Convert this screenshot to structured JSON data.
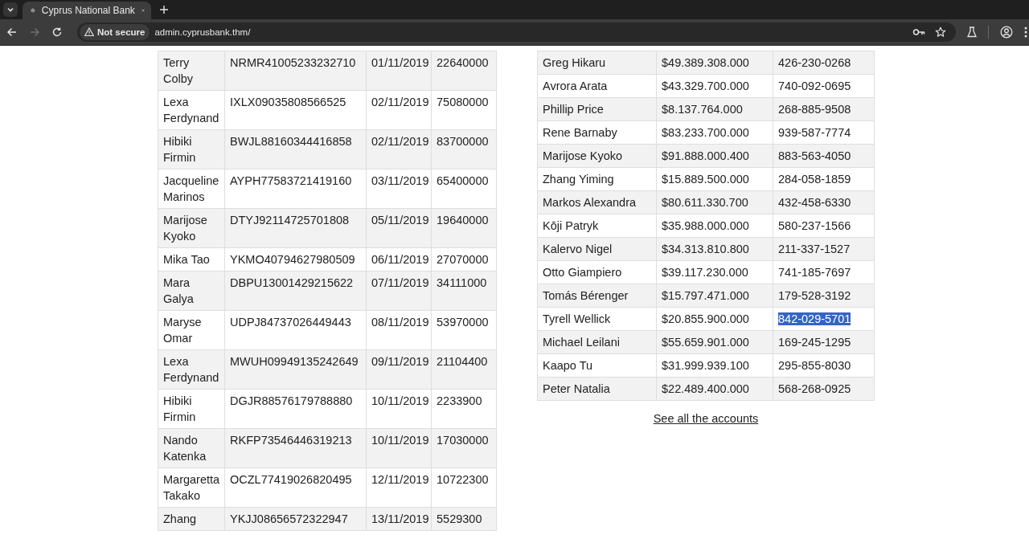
{
  "browser": {
    "tab": {
      "title": "Cyprus National Bank",
      "selected": true
    },
    "security": "Not secure",
    "url": "admin.cyprusbank.thm/",
    "forward_disabled": true
  },
  "transactions": {
    "rows": [
      {
        "name": "Terry Colby",
        "account": "NRMR41005233232710",
        "date": "01/11/2019",
        "amount": "22640000"
      },
      {
        "name": "Lexa Ferdynand",
        "account": "IXLX09035808566525",
        "date": "02/11/2019",
        "amount": "75080000"
      },
      {
        "name": "Hibiki Firmin",
        "account": "BWJL88160344416858",
        "date": "02/11/2019",
        "amount": "83700000"
      },
      {
        "name": "Jacqueline Marinos",
        "account": "AYPH77583721419160",
        "date": "03/11/2019",
        "amount": "65400000"
      },
      {
        "name": "Marijose Kyoko",
        "account": "DTYJ92114725701808",
        "date": "05/11/2019",
        "amount": "19640000"
      },
      {
        "name": "Mika Tao",
        "account": "YKMO40794627980509",
        "date": "06/11/2019",
        "amount": "27070000"
      },
      {
        "name": "Mara Galya",
        "account": "DBPU13001429215622",
        "date": "07/11/2019",
        "amount": "34111000"
      },
      {
        "name": "Maryse Omar",
        "account": "UDPJ84737026449443",
        "date": "08/11/2019",
        "amount": "53970000"
      },
      {
        "name": "Lexa Ferdynand",
        "account": "MWUH09949135242649",
        "date": "09/11/2019",
        "amount": "21104400"
      },
      {
        "name": "Hibiki Firmin",
        "account": "DGJR88576179788880",
        "date": "10/11/2019",
        "amount": "2233900"
      },
      {
        "name": "Nando Katenka",
        "account": "RKFP73546446319213",
        "date": "10/11/2019",
        "amount": "17030000"
      },
      {
        "name": "Margaretta Takako",
        "account": "OCZL77419026820495",
        "date": "12/11/2019",
        "amount": "10722300"
      },
      {
        "name": "Zhang",
        "account": "YKJJ08656572322947",
        "date": "13/11/2019",
        "amount": "5529300"
      }
    ]
  },
  "accounts": {
    "rows": [
      {
        "name": "Greg Hikaru",
        "balance": "$49.389.308.000",
        "phone": "426-230-0268",
        "phone_selected": false
      },
      {
        "name": "Avrora Arata",
        "balance": "$43.329.700.000",
        "phone": "740-092-0695",
        "phone_selected": false
      },
      {
        "name": "Phillip Price",
        "balance": "$8.137.764.000",
        "phone": "268-885-9508",
        "phone_selected": false
      },
      {
        "name": "Rene Barnaby",
        "balance": "$83.233.700.000",
        "phone": "939-587-7774",
        "phone_selected": false
      },
      {
        "name": "Marijose Kyoko",
        "balance": "$91.888.000.400",
        "phone": "883-563-4050",
        "phone_selected": false
      },
      {
        "name": "Zhang Yiming",
        "balance": "$15.889.500.000",
        "phone": "284-058-1859",
        "phone_selected": false
      },
      {
        "name": "Markos Alexandra",
        "balance": "$80.611.330.700",
        "phone": "432-458-6330",
        "phone_selected": false
      },
      {
        "name": "Kōji Patryk",
        "balance": "$35.988.000.000",
        "phone": "580-237-1566",
        "phone_selected": false
      },
      {
        "name": "Kalervo Nigel",
        "balance": "$34.313.810.800",
        "phone": "211-337-1527",
        "phone_selected": false
      },
      {
        "name": "Otto Giampiero",
        "balance": "$39.117.230.000",
        "phone": "741-185-7697",
        "phone_selected": false
      },
      {
        "name": "Tomás Bérenger",
        "balance": "$15.797.471.000",
        "phone": "179-528-3192",
        "phone_selected": false
      },
      {
        "name": "Tyrell Wellick",
        "balance": "$20.855.900.000",
        "phone": "842-029-5701",
        "phone_selected": true
      },
      {
        "name": "Michael Leilani",
        "balance": "$55.659.901.000",
        "phone": "169-245-1295",
        "phone_selected": false
      },
      {
        "name": "Kaapo Tu",
        "balance": "$31.999.939.100",
        "phone": "295-855-8030",
        "phone_selected": false
      },
      {
        "name": "Peter Natalia",
        "balance": "$22.489.400.000",
        "phone": "568-268-0925",
        "phone_selected": false
      }
    ],
    "link": "See all the accounts"
  }
}
